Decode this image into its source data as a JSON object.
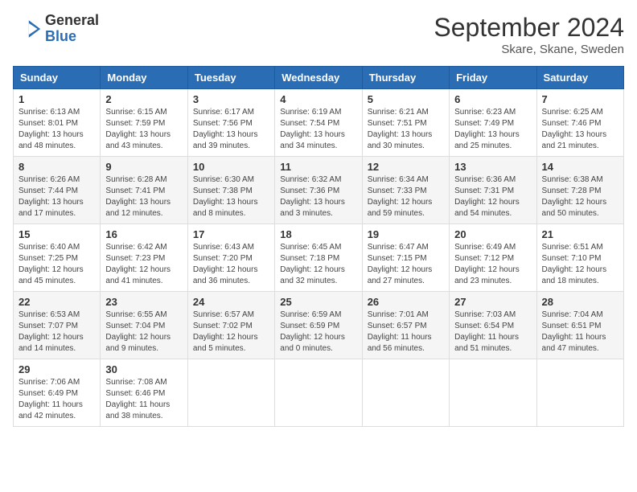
{
  "header": {
    "logo_general": "General",
    "logo_blue": "Blue",
    "month_title": "September 2024",
    "location": "Skare, Skane, Sweden"
  },
  "days_of_week": [
    "Sunday",
    "Monday",
    "Tuesday",
    "Wednesday",
    "Thursday",
    "Friday",
    "Saturday"
  ],
  "weeks": [
    [
      {
        "day": "1",
        "sunrise": "6:13 AM",
        "sunset": "8:01 PM",
        "daylight": "13 hours and 48 minutes."
      },
      {
        "day": "2",
        "sunrise": "6:15 AM",
        "sunset": "7:59 PM",
        "daylight": "13 hours and 43 minutes."
      },
      {
        "day": "3",
        "sunrise": "6:17 AM",
        "sunset": "7:56 PM",
        "daylight": "13 hours and 39 minutes."
      },
      {
        "day": "4",
        "sunrise": "6:19 AM",
        "sunset": "7:54 PM",
        "daylight": "13 hours and 34 minutes."
      },
      {
        "day": "5",
        "sunrise": "6:21 AM",
        "sunset": "7:51 PM",
        "daylight": "13 hours and 30 minutes."
      },
      {
        "day": "6",
        "sunrise": "6:23 AM",
        "sunset": "7:49 PM",
        "daylight": "13 hours and 25 minutes."
      },
      {
        "day": "7",
        "sunrise": "6:25 AM",
        "sunset": "7:46 PM",
        "daylight": "13 hours and 21 minutes."
      }
    ],
    [
      {
        "day": "8",
        "sunrise": "6:26 AM",
        "sunset": "7:44 PM",
        "daylight": "13 hours and 17 minutes."
      },
      {
        "day": "9",
        "sunrise": "6:28 AM",
        "sunset": "7:41 PM",
        "daylight": "13 hours and 12 minutes."
      },
      {
        "day": "10",
        "sunrise": "6:30 AM",
        "sunset": "7:38 PM",
        "daylight": "13 hours and 8 minutes."
      },
      {
        "day": "11",
        "sunrise": "6:32 AM",
        "sunset": "7:36 PM",
        "daylight": "13 hours and 3 minutes."
      },
      {
        "day": "12",
        "sunrise": "6:34 AM",
        "sunset": "7:33 PM",
        "daylight": "12 hours and 59 minutes."
      },
      {
        "day": "13",
        "sunrise": "6:36 AM",
        "sunset": "7:31 PM",
        "daylight": "12 hours and 54 minutes."
      },
      {
        "day": "14",
        "sunrise": "6:38 AM",
        "sunset": "7:28 PM",
        "daylight": "12 hours and 50 minutes."
      }
    ],
    [
      {
        "day": "15",
        "sunrise": "6:40 AM",
        "sunset": "7:25 PM",
        "daylight": "12 hours and 45 minutes."
      },
      {
        "day": "16",
        "sunrise": "6:42 AM",
        "sunset": "7:23 PM",
        "daylight": "12 hours and 41 minutes."
      },
      {
        "day": "17",
        "sunrise": "6:43 AM",
        "sunset": "7:20 PM",
        "daylight": "12 hours and 36 minutes."
      },
      {
        "day": "18",
        "sunrise": "6:45 AM",
        "sunset": "7:18 PM",
        "daylight": "12 hours and 32 minutes."
      },
      {
        "day": "19",
        "sunrise": "6:47 AM",
        "sunset": "7:15 PM",
        "daylight": "12 hours and 27 minutes."
      },
      {
        "day": "20",
        "sunrise": "6:49 AM",
        "sunset": "7:12 PM",
        "daylight": "12 hours and 23 minutes."
      },
      {
        "day": "21",
        "sunrise": "6:51 AM",
        "sunset": "7:10 PM",
        "daylight": "12 hours and 18 minutes."
      }
    ],
    [
      {
        "day": "22",
        "sunrise": "6:53 AM",
        "sunset": "7:07 PM",
        "daylight": "12 hours and 14 minutes."
      },
      {
        "day": "23",
        "sunrise": "6:55 AM",
        "sunset": "7:04 PM",
        "daylight": "12 hours and 9 minutes."
      },
      {
        "day": "24",
        "sunrise": "6:57 AM",
        "sunset": "7:02 PM",
        "daylight": "12 hours and 5 minutes."
      },
      {
        "day": "25",
        "sunrise": "6:59 AM",
        "sunset": "6:59 PM",
        "daylight": "12 hours and 0 minutes."
      },
      {
        "day": "26",
        "sunrise": "7:01 AM",
        "sunset": "6:57 PM",
        "daylight": "11 hours and 56 minutes."
      },
      {
        "day": "27",
        "sunrise": "7:03 AM",
        "sunset": "6:54 PM",
        "daylight": "11 hours and 51 minutes."
      },
      {
        "day": "28",
        "sunrise": "7:04 AM",
        "sunset": "6:51 PM",
        "daylight": "11 hours and 47 minutes."
      }
    ],
    [
      {
        "day": "29",
        "sunrise": "7:06 AM",
        "sunset": "6:49 PM",
        "daylight": "11 hours and 42 minutes."
      },
      {
        "day": "30",
        "sunrise": "7:08 AM",
        "sunset": "6:46 PM",
        "daylight": "11 hours and 38 minutes."
      },
      null,
      null,
      null,
      null,
      null
    ]
  ]
}
